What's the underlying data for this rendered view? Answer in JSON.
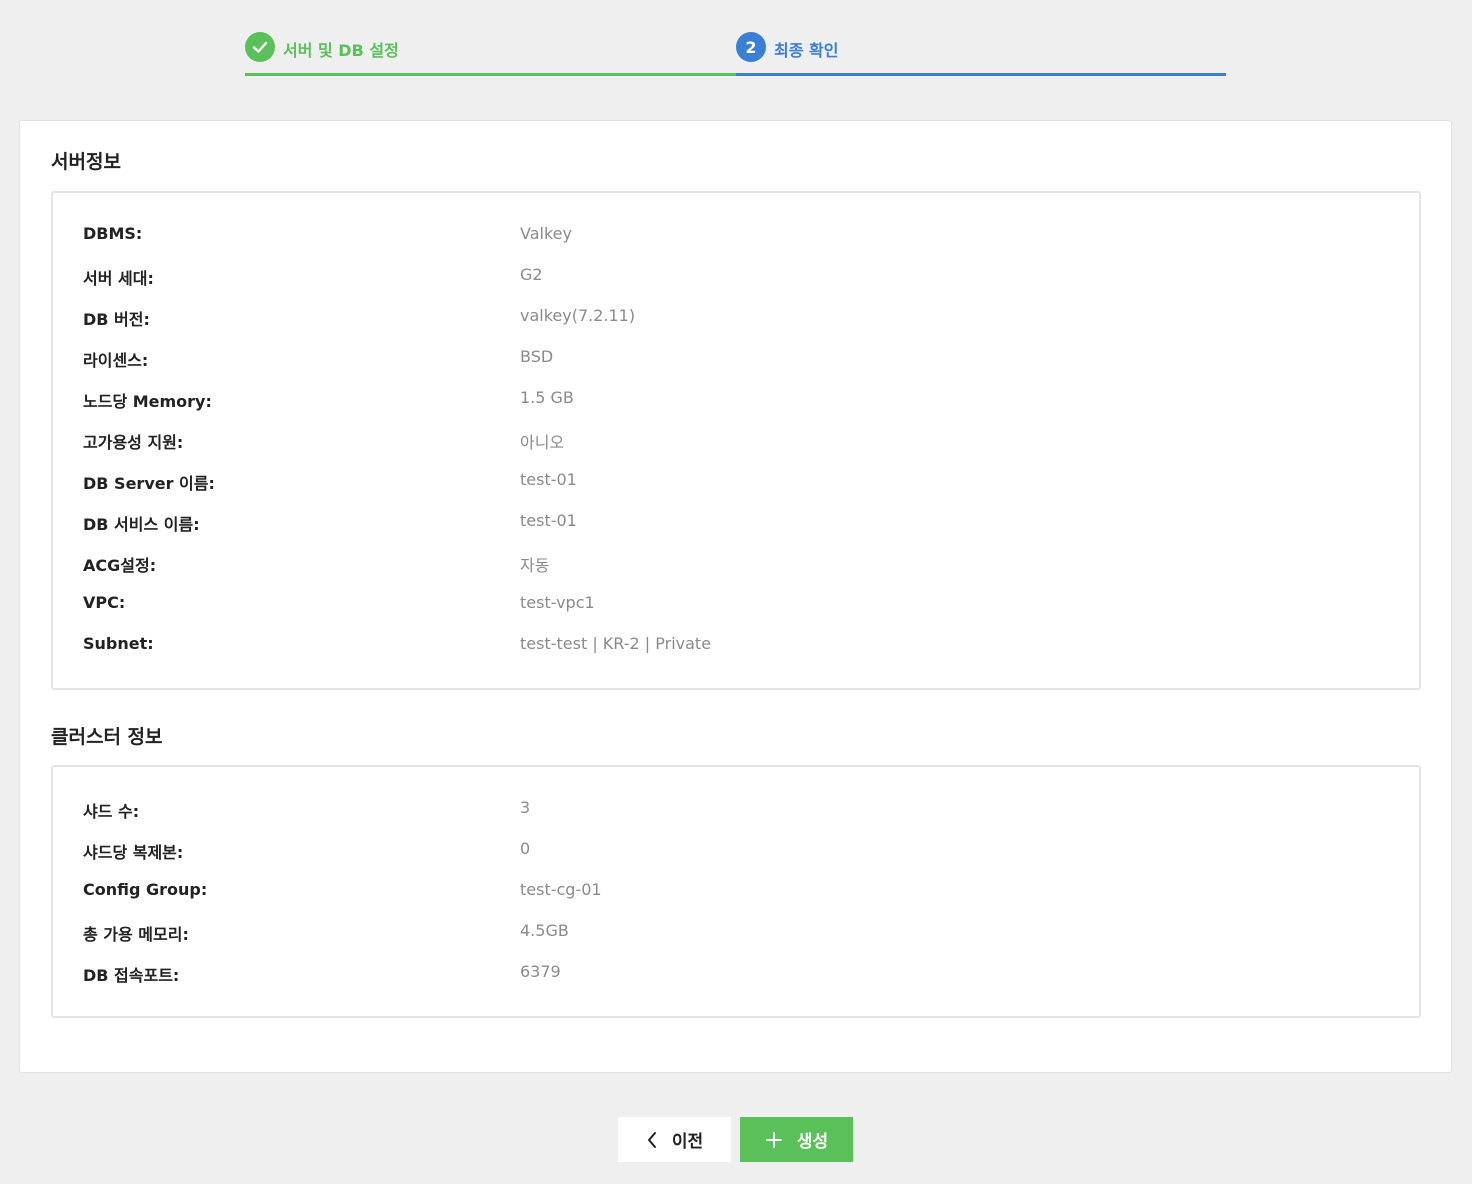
{
  "stepper": {
    "steps": [
      {
        "number": "✓",
        "label": "서버 및 DB 설정",
        "status": "completed",
        "color": "#5ac05a"
      },
      {
        "number": "2",
        "label": "최종 확인",
        "status": "active",
        "color": "#3a7fd4"
      }
    ]
  },
  "server_info": {
    "title": "서버정보",
    "rows": [
      {
        "label": "DBMS:",
        "value": "Valkey"
      },
      {
        "label": "서버 세대:",
        "value": "G2"
      },
      {
        "label": "DB 버전:",
        "value": "valkey(7.2.11)"
      },
      {
        "label": "라이센스:",
        "value": "BSD"
      },
      {
        "label": "노드당 Memory:",
        "value": "1.5 GB"
      },
      {
        "label": "고가용성 지원:",
        "value": "아니오"
      },
      {
        "label": "DB Server 이름:",
        "value": "test-01"
      },
      {
        "label": "DB 서비스 이름:",
        "value": "test-01"
      },
      {
        "label": "ACG설정:",
        "value": "자동"
      },
      {
        "label": "VPC:",
        "value": "test-vpc1"
      },
      {
        "label": "Subnet:",
        "value": "test-test | KR-2 | Private"
      }
    ]
  },
  "cluster_info": {
    "title": "클러스터 정보",
    "rows": [
      {
        "label": "샤드 수:",
        "value": "3"
      },
      {
        "label": "샤드당 복제본:",
        "value": "0"
      },
      {
        "label": "Config Group:",
        "value": "test-cg-01"
      },
      {
        "label": "총 가용 메모리:",
        "value": "4.5GB"
      },
      {
        "label": "DB 접속포트:",
        "value": "6379"
      }
    ]
  },
  "buttons": {
    "prev_label": "이전",
    "prev_icon": "chevron-left-icon",
    "create_label": "생성",
    "create_icon": "plus-icon",
    "create_color": "#5ac05a"
  }
}
